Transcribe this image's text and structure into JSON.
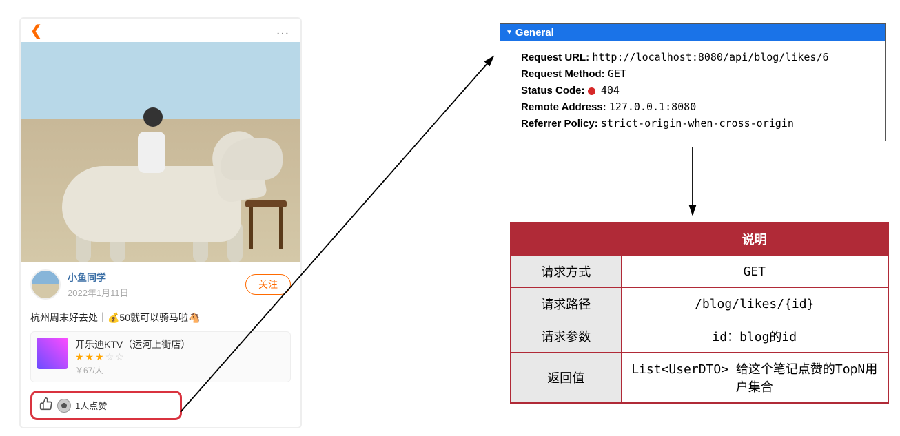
{
  "phone": {
    "user_name": "小鱼同学",
    "user_date": "2022年1月11日",
    "follow_label": "关注",
    "post_title": "杭州周末好去处｜💰50就可以骑马啦🐴",
    "location": {
      "name": "开乐迪KTV（运河上街店）",
      "stars_filled": "★★★",
      "stars_empty": "☆☆",
      "price": "￥67/人"
    },
    "like_text": "1人点赞"
  },
  "devtools": {
    "header": "General",
    "rows": {
      "request_url_label": "Request URL:",
      "request_url_value": "http://localhost:8080/api/blog/likes/6",
      "request_method_label": "Request Method:",
      "request_method_value": "GET",
      "status_code_label": "Status Code:",
      "status_code_value": "404",
      "remote_address_label": "Remote Address:",
      "remote_address_value": "127.0.0.1:8080",
      "referrer_policy_label": "Referrer Policy:",
      "referrer_policy_value": "strict-origin-when-cross-origin"
    }
  },
  "spec": {
    "header_col2": "说明",
    "rows": [
      {
        "label": "请求方式",
        "value": "GET"
      },
      {
        "label": "请求路径",
        "value": "/blog/likes/{id}"
      },
      {
        "label": "请求参数",
        "value": "id：blog的id"
      },
      {
        "label": "返回值",
        "value": "List<UserDTO> 给这个笔记点赞的TopN用户集合"
      }
    ]
  }
}
